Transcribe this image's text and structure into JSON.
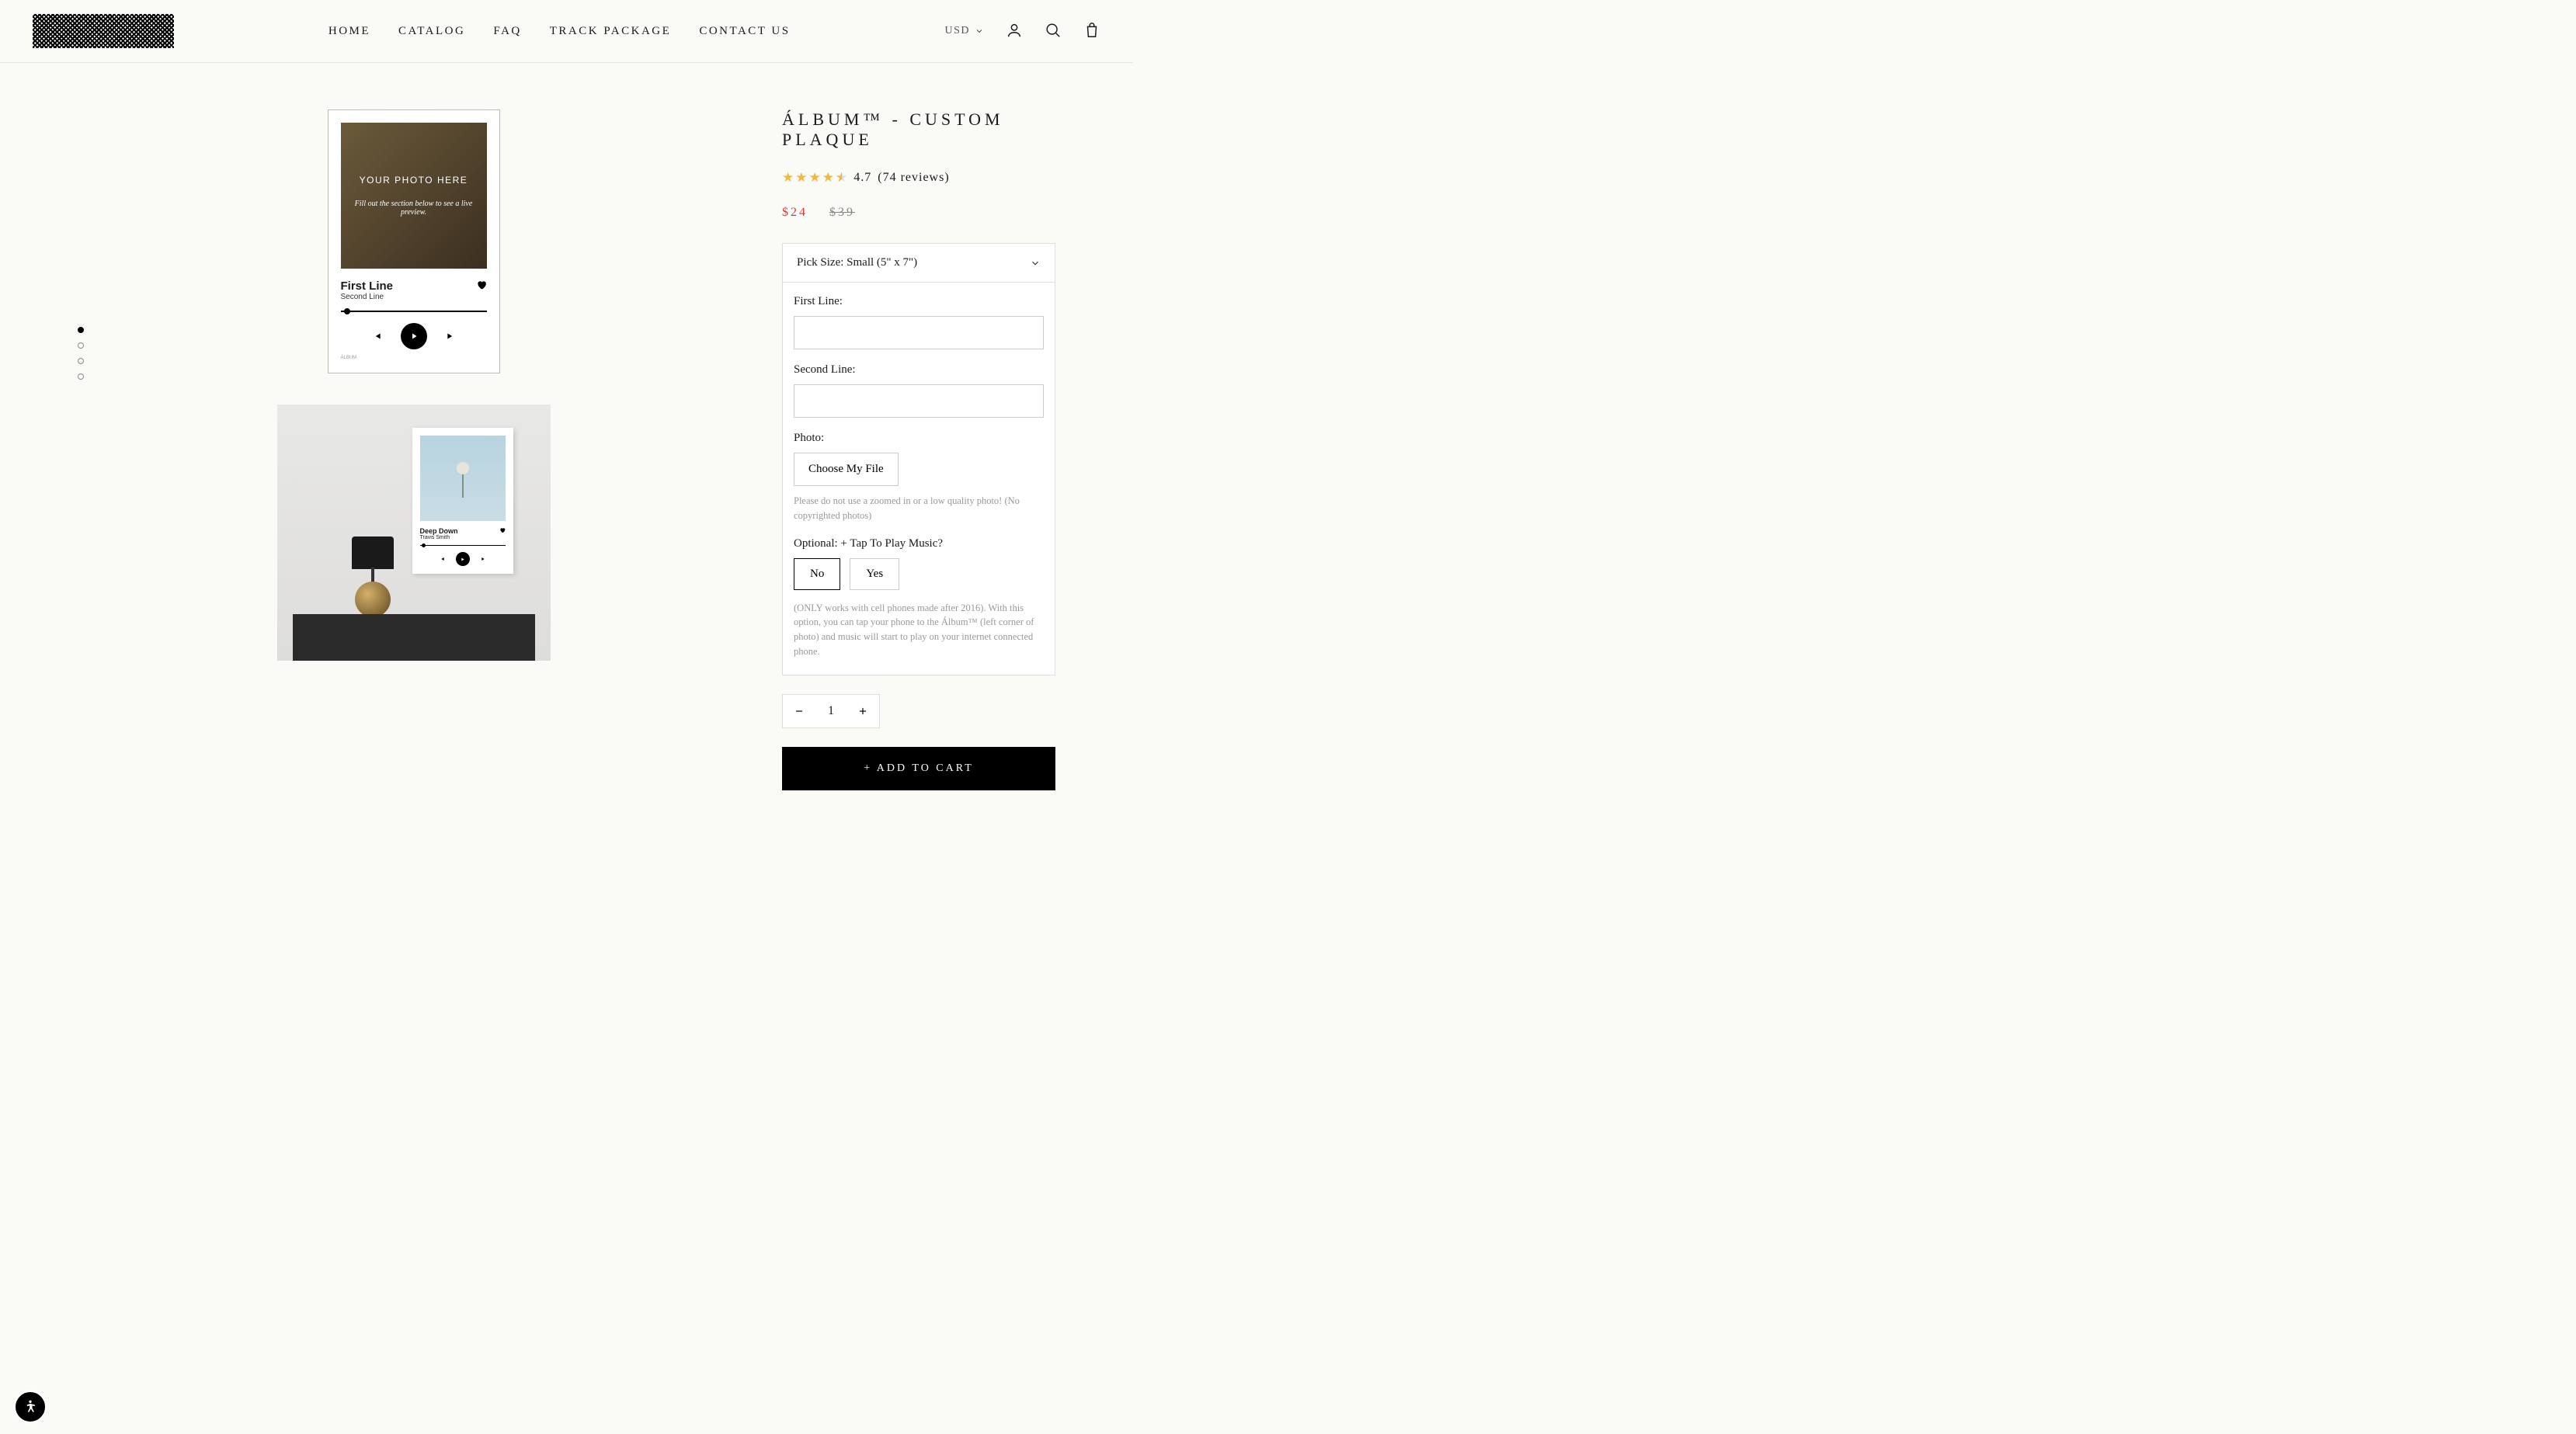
{
  "nav": {
    "items": [
      "HOME",
      "CATALOG",
      "FAQ",
      "TRACK PACKAGE",
      "CONTACT US"
    ]
  },
  "currency": {
    "label": "USD"
  },
  "product": {
    "title": "ÁLBUM™ - CUSTOM PLAQUE",
    "rating_value": "4.7",
    "rating_count": "(74 reviews)",
    "price": "$24",
    "compare_price": "$39"
  },
  "plaque_preview": {
    "overlay_title": "YOUR PHOTO HERE",
    "overlay_sub": "Fill out the section below to see a live preview.",
    "line1": "First Line",
    "line2": "Second Line",
    "footer": "ÁLBUM"
  },
  "scene_preview": {
    "line1": "Deep Down",
    "line2": "Travis Smith"
  },
  "form": {
    "size_label": "Pick Size:",
    "size_value": "Small (5\" x 7\")",
    "first_line_label": "First Line:",
    "second_line_label": "Second Line:",
    "photo_label": "Photo:",
    "choose_file": "Choose My File",
    "photo_hint": "Please do not use a zoomed in or a low quality photo! (No copyrighted photos)",
    "music_label": "Optional: + Tap To Play Music?",
    "option_no": "No",
    "option_yes": "Yes",
    "music_hint": "(ONLY works with cell phones made after 2016). With this option, you can tap your phone to the Álbum™ (left corner of photo) and music will start to play on your internet connected phone.",
    "quantity": "1",
    "add_to_cart": "+ ADD TO CART"
  }
}
